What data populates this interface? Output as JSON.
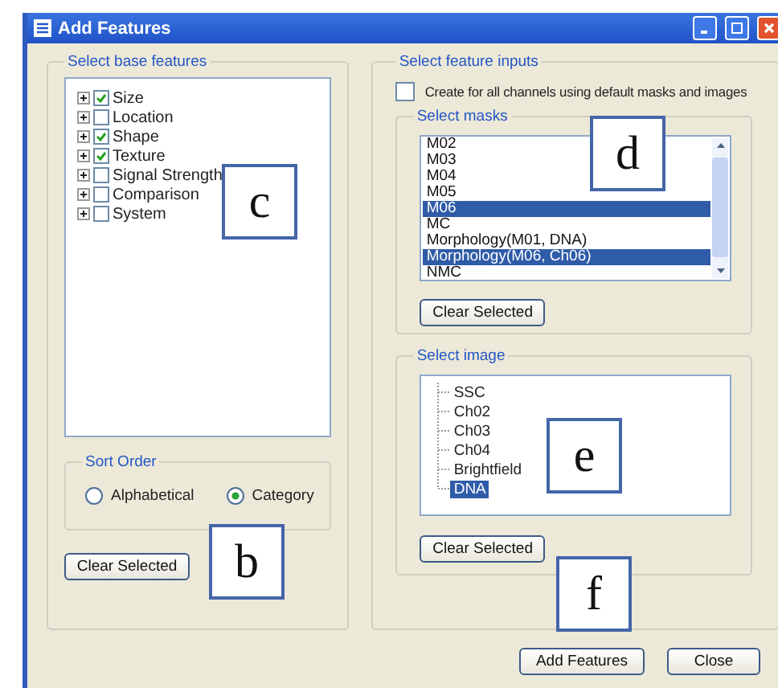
{
  "window": {
    "title": "Add Features"
  },
  "base_features": {
    "legend": "Select base features",
    "items": [
      {
        "label": "Size",
        "checked": true
      },
      {
        "label": "Location",
        "checked": false
      },
      {
        "label": "Shape",
        "checked": true
      },
      {
        "label": "Texture",
        "checked": true
      },
      {
        "label": "Signal Strength",
        "checked": false
      },
      {
        "label": "Comparison",
        "checked": false
      },
      {
        "label": "System",
        "checked": false
      }
    ],
    "sort_order": {
      "legend": "Sort Order",
      "options": [
        {
          "label": "Alphabetical",
          "selected": false
        },
        {
          "label": "Category",
          "selected": true
        }
      ]
    },
    "button": "Clear Selected"
  },
  "feature_inputs": {
    "legend": "Select feature inputs",
    "all_channels": {
      "label": "Create for all channels using default masks and images",
      "checked": false
    },
    "masks": {
      "legend": "Select masks",
      "items": [
        {
          "label": "M02",
          "selected": false
        },
        {
          "label": "M03",
          "selected": false
        },
        {
          "label": "M04",
          "selected": false
        },
        {
          "label": "M05",
          "selected": false
        },
        {
          "label": "M06",
          "selected": true
        },
        {
          "label": "MC",
          "selected": false
        },
        {
          "label": "Morphology(M01, DNA)",
          "selected": false
        },
        {
          "label": "Morphology(M06, Ch06)",
          "selected": true
        },
        {
          "label": "NMC",
          "selected": false
        }
      ],
      "button": "Clear Selected"
    },
    "image": {
      "legend": "Select image",
      "items": [
        {
          "label": "SSC",
          "selected": false
        },
        {
          "label": "Ch02",
          "selected": false
        },
        {
          "label": "Ch03",
          "selected": false
        },
        {
          "label": "Ch04",
          "selected": false
        },
        {
          "label": "Brightfield",
          "selected": false
        },
        {
          "label": "DNA",
          "selected": true
        }
      ],
      "button": "Clear Selected"
    }
  },
  "buttons": [
    "Add Features",
    "Close"
  ],
  "callouts": [
    "c",
    "d",
    "e",
    "b",
    "f"
  ]
}
